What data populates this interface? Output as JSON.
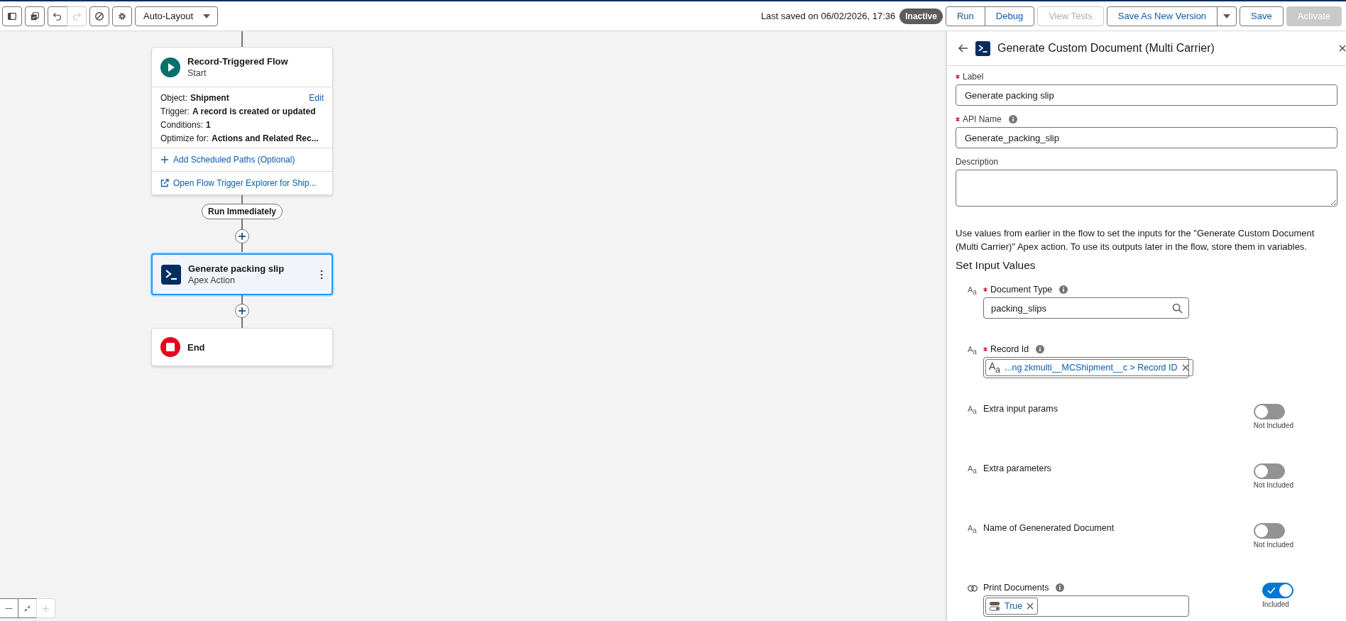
{
  "toolbar": {
    "icon_groups": [
      [
        {
          "kind": "panel",
          "disabled": false
        }
      ],
      [
        {
          "kind": "copy",
          "disabled": false
        }
      ],
      [
        {
          "kind": "undo",
          "disabled": false
        },
        {
          "kind": "redo",
          "disabled": true
        }
      ],
      [
        {
          "kind": "ban",
          "disabled": false
        }
      ],
      [
        {
          "kind": "gear",
          "disabled": false
        }
      ]
    ],
    "layout_menu": "Auto-Layout",
    "last_saved": "Last saved on 06/02/2026, 17:36",
    "status": "Inactive",
    "button_groups": [
      [
        {
          "label": "Run",
          "disabled": false
        },
        {
          "label": "Debug",
          "disabled": false
        }
      ],
      [
        {
          "label": "View Tests",
          "disabled": true
        }
      ],
      [
        {
          "label": "Save As New Version",
          "disabled": false,
          "menu": true
        }
      ],
      [
        {
          "label": "Save",
          "disabled": false
        }
      ],
      [
        {
          "label": "Activate",
          "disabled": true,
          "kind": "brand"
        }
      ]
    ]
  },
  "flow": {
    "start": {
      "title": "Record-Triggered Flow",
      "subtitle": "Start",
      "edit": "Edit",
      "details": [
        {
          "label": "Object:",
          "value": "Shipment"
        },
        {
          "label": "Trigger:",
          "value": "A record is created or updated"
        },
        {
          "label": "Conditions:",
          "value": "1"
        },
        {
          "label": "Optimize for:",
          "value": "Actions and Related Rec..."
        }
      ],
      "links": [
        {
          "kind": "add",
          "label": "Add Scheduled Paths (Optional)"
        },
        {
          "kind": "external",
          "label": "Open Flow Trigger Explorer for Ship..."
        }
      ]
    },
    "path_label": "Run Immediately",
    "action": {
      "title": "Generate packing slip",
      "subtitle": "Apex Action",
      "selected": true
    },
    "end": {
      "title": "End"
    }
  },
  "zoom_controls": [
    {
      "kind": "minus",
      "disabled": false
    },
    {
      "kind": "fit",
      "disabled": false
    },
    {
      "kind": "plus",
      "disabled": true
    }
  ],
  "panel": {
    "title": "Generate Custom Document (Multi Carrier)",
    "label_field": {
      "label": "Label",
      "required": true,
      "value": "Generate packing slip"
    },
    "api_name_field": {
      "label": "API Name",
      "required": true,
      "info": true,
      "value": "Generate_packing_slip"
    },
    "description_field": {
      "label": "Description"
    },
    "help_text": "Use values from earlier in the flow to set the inputs for the \"Generate Custom Document (Multi Carrier)\" Apex action. To use its outputs later in the flow, store them in variables.",
    "section_title": "Set Input Values",
    "inputs": [
      {
        "kind": "text",
        "type_glyph": "A$_{a}$",
        "label": "Document Type",
        "required": true,
        "info": true,
        "field": {
          "kind": "lookup",
          "value": "packing_slips"
        }
      },
      {
        "kind": "text",
        "type_glyph": "A$_{a}$",
        "label": "Record Id",
        "required": true,
        "info": true,
        "field": {
          "kind": "text_pill",
          "pill_glyph": "A$_{a}$",
          "value": "...ng zkmulti__MCShipment__c > Record ID"
        }
      },
      {
        "kind": "text",
        "type_glyph": "A$_{a}$",
        "label": "Extra input params",
        "required": false,
        "info": false,
        "toggle": {
          "on": false,
          "label": "Not Included"
        }
      },
      {
        "kind": "text",
        "type_glyph": "A$_{a}$",
        "label": "Extra parameters",
        "required": false,
        "info": false,
        "toggle": {
          "on": false,
          "label": "Not Included"
        }
      },
      {
        "kind": "text",
        "type_glyph": "A$_{a}$",
        "label": "Name of Genenerated Document",
        "required": false,
        "info": false,
        "toggle": {
          "on": false,
          "label": "Not Included"
        }
      },
      {
        "kind": "boolean",
        "label": "Print Documents",
        "required": false,
        "info": true,
        "field": {
          "kind": "boolean_pill",
          "value": "True"
        },
        "toggle": {
          "on": true,
          "label": "Included"
        }
      }
    ]
  }
}
